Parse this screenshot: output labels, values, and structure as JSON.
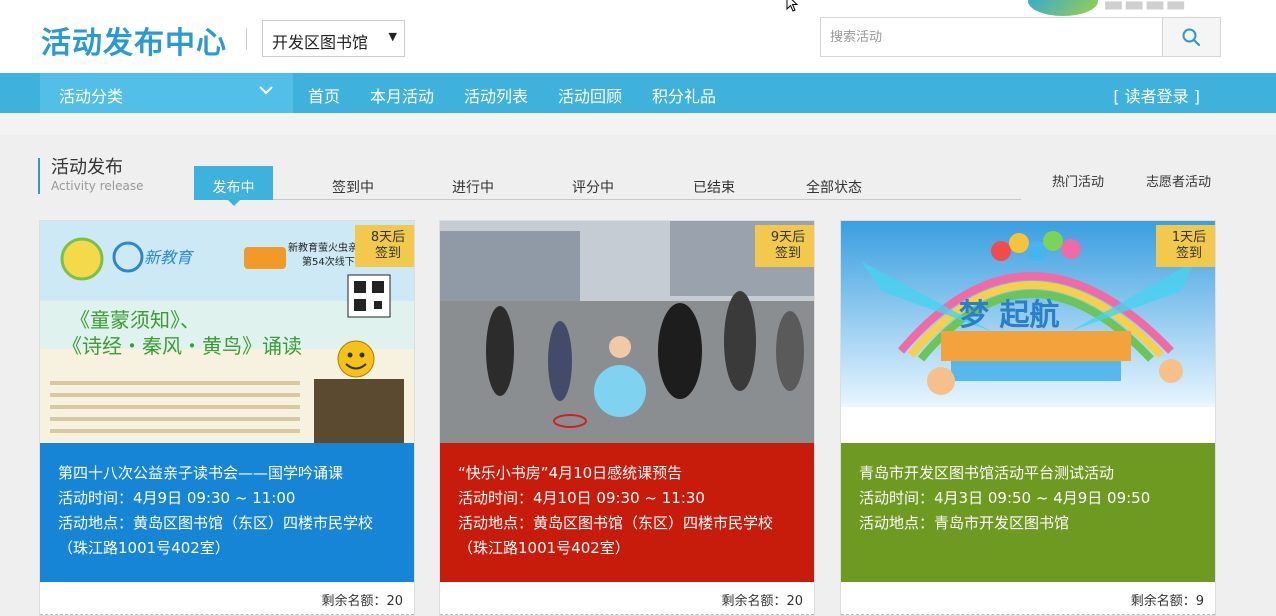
{
  "header": {
    "logo": "活动发布中心",
    "library_select": "开发区图书馆",
    "search_placeholder": "搜索活动"
  },
  "nav": {
    "category": "活动分类",
    "items": [
      "首页",
      "本月活动",
      "活动列表",
      "活动回顾",
      "积分礼品"
    ],
    "login": "[ 读者登录 ]"
  },
  "section": {
    "title": "活动发布",
    "subtitle": "Activity release",
    "tabs": [
      "发布中",
      "签到中",
      "进行中",
      "评分中",
      "已结束",
      "全部状态"
    ],
    "side_links": [
      "热门活动",
      "志愿者活动"
    ]
  },
  "cards": [
    {
      "badge": [
        "8天后",
        "签到"
      ],
      "title": "第四十八次公益亲子读书会——国学吟诵课",
      "time": "活动时间：4月9日 09:30 ~ 11:00",
      "place": "活动地点：黄岛区图书馆（东区）四楼市民学校（珠江路1001号402室）",
      "remaining": "剩余名额：20",
      "color": "#1785d6"
    },
    {
      "badge": [
        "9天后",
        "签到"
      ],
      "title": "“快乐小书房”4月10日感统课预告",
      "time": "活动时间：4月10日 09:30 ~ 11:30",
      "place": "活动地点：黄岛区图书馆（东区）四楼市民学校（珠江路1001号402室）",
      "remaining": "剩余名额：20",
      "color": "#c71b0c"
    },
    {
      "badge": [
        "1天后",
        "签到"
      ],
      "title": "青岛市开发区图书馆活动平台测试活动",
      "time": "活动时间：4月3日 09:50 ~ 4月9日 09:50",
      "place": "活动地点：青岛市开发区图书馆",
      "remaining": "剩余名额：9",
      "color": "#6e9a21"
    }
  ],
  "poster1": {
    "brand": "新教育",
    "headline": "新教育萤火虫亲",
    "subline": "第54次线下",
    "line1": "《童蒙须知》、",
    "line2": "《诗经・秦风・黄鸟》诵读"
  },
  "poster3": {
    "text": "梦 起航"
  }
}
